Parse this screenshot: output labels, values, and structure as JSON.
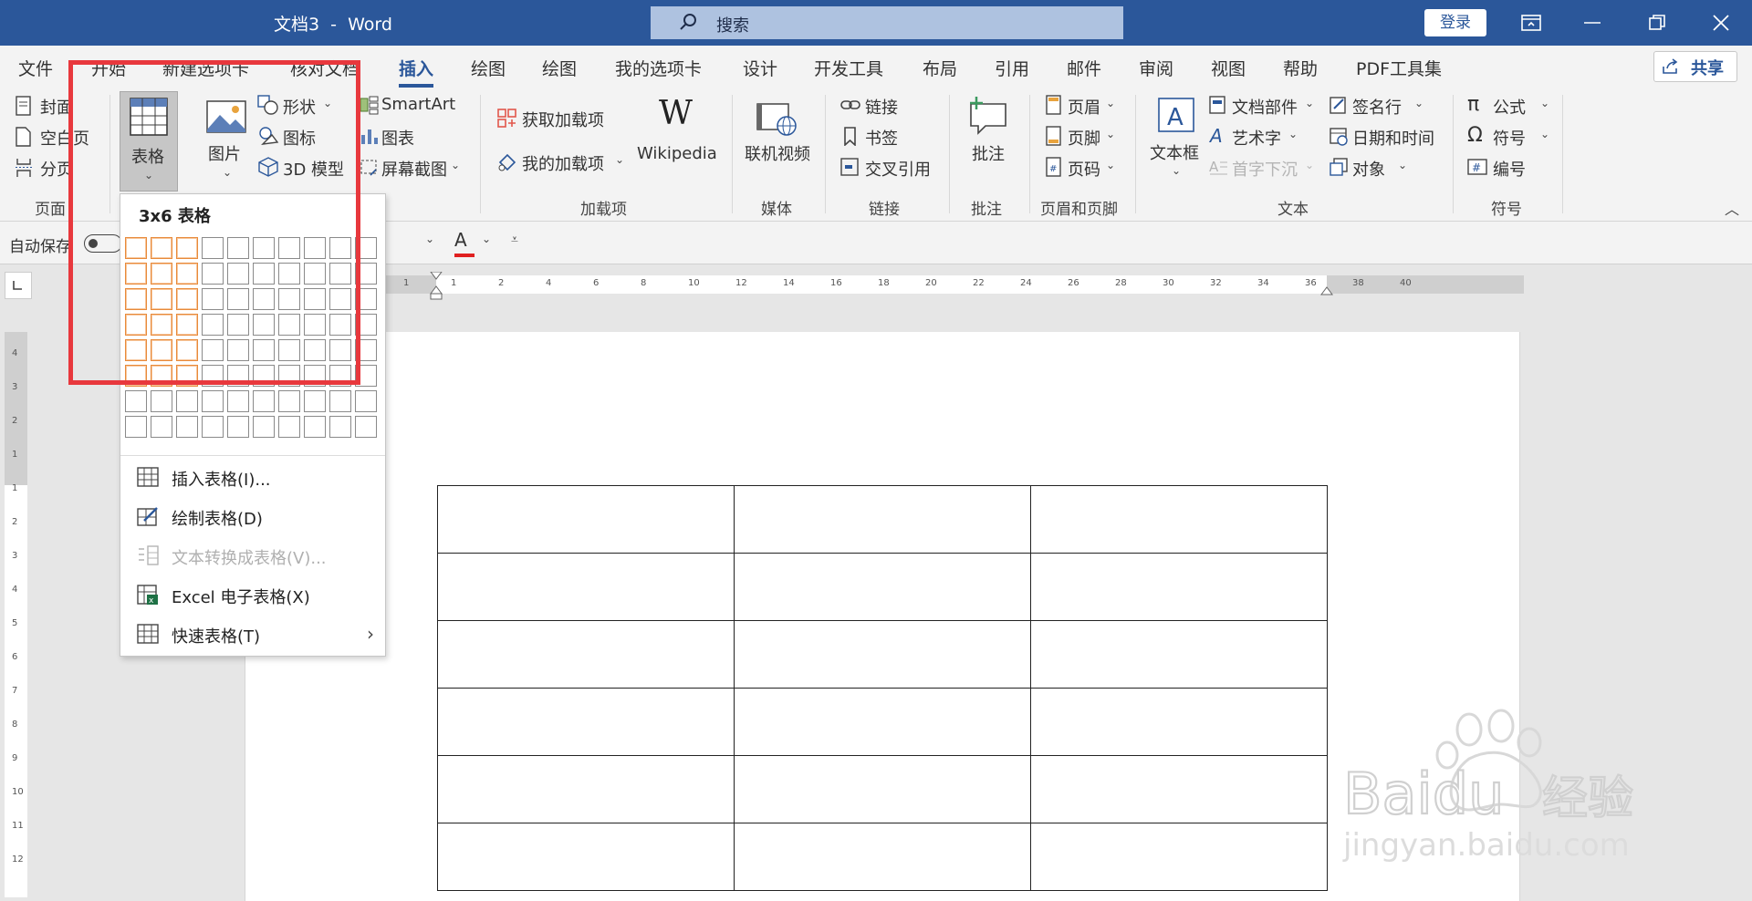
{
  "titlebar": {
    "title": "文档3  -  Word",
    "search_placeholder": "搜索",
    "login": "登录"
  },
  "tabs": [
    "文件",
    "开始",
    "新建选项卡",
    "核对文档",
    "插入",
    "绘图",
    "绘图",
    "我的选项卡",
    "设计",
    "开发工具",
    "布局",
    "引用",
    "邮件",
    "审阅",
    "视图",
    "帮助",
    "PDF工具集"
  ],
  "active_tab": "插入",
  "share": "共享",
  "ribbon": {
    "pages": {
      "cover": "封面",
      "blank": "空白页",
      "break": "分页",
      "label": "页面"
    },
    "table": {
      "label": "表格"
    },
    "illustrations": {
      "picture": "图片",
      "shapes": "形状",
      "icons": "图标",
      "model3d": "3D 模型",
      "smartart": "SmartArt",
      "chart": "图表",
      "screenshot": "屏幕截图"
    },
    "addins": {
      "get": "获取加载项",
      "mine": "我的加载项",
      "wikipedia": "Wikipedia",
      "label": "加载项"
    },
    "media": {
      "video": "联机视频",
      "label": "媒体"
    },
    "links": {
      "link": "链接",
      "bookmark": "书签",
      "crossref": "交叉引用",
      "label": "链接"
    },
    "comments": {
      "comment": "批注",
      "label": "批注"
    },
    "headerfooter": {
      "header": "页眉",
      "footer": "页脚",
      "pagenum": "页码",
      "label": "页眉和页脚"
    },
    "text": {
      "textbox": "文本框",
      "quickparts": "文档部件",
      "wordart": "艺术字",
      "dropcap": "首字下沉",
      "sigline": "签名行",
      "datetime": "日期和时间",
      "object": "对象",
      "label": "文本"
    },
    "symbols": {
      "equation": "公式",
      "symbol": "符号",
      "number": "编号",
      "label": "符号"
    }
  },
  "qat": {
    "autosave": "自动保存",
    "fontcolor": "A"
  },
  "dropdown": {
    "title": "3x6 表格",
    "grid_cols": 10,
    "grid_rows": 8,
    "selected_cols": 3,
    "selected_rows": 6,
    "items": [
      {
        "label": "插入表格(I)...",
        "enabled": true
      },
      {
        "label": "绘制表格(D)",
        "enabled": true
      },
      {
        "label": "文本转换成表格(V)...",
        "enabled": false
      },
      {
        "label": "Excel 电子表格(X)",
        "enabled": true
      },
      {
        "label": "快速表格(T)",
        "enabled": true
      }
    ]
  },
  "ruler": {
    "h_ticks": [
      "1",
      "1",
      "2",
      "4",
      "6",
      "8",
      "10",
      "12",
      "14",
      "16",
      "18",
      "20",
      "22",
      "24",
      "26",
      "28",
      "30",
      "32",
      "34",
      "36",
      "38",
      "40"
    ],
    "v_ticks": [
      "4",
      "3",
      "2",
      "1",
      "1",
      "2",
      "3",
      "4",
      "5",
      "6",
      "7",
      "8",
      "9",
      "10",
      "11",
      "12"
    ]
  },
  "document": {
    "table_rows": 6,
    "table_cols": 3
  },
  "watermark": {
    "brand": "Baidu",
    "cn": "经验",
    "url": "jingyan.baidu.com"
  },
  "colors": {
    "accent": "#2b579a",
    "highlight": "#e8383d",
    "grid_selected": "#e88a3a"
  }
}
